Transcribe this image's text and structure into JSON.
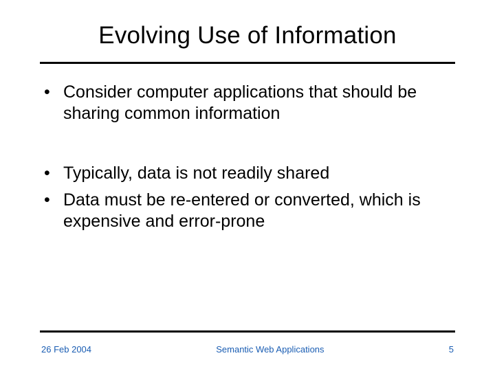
{
  "slide": {
    "title": "Evolving Use of Information",
    "bullets": [
      "Consider computer applications that should be sharing common information",
      "Typically, data is not readily shared",
      "Data must be re-entered or converted, which is expensive and error-prone"
    ],
    "footer": {
      "date": "26 Feb 2004",
      "center": "Semantic Web Applications",
      "page": "5"
    },
    "colors": {
      "footer_text": "#1a5db3"
    }
  }
}
